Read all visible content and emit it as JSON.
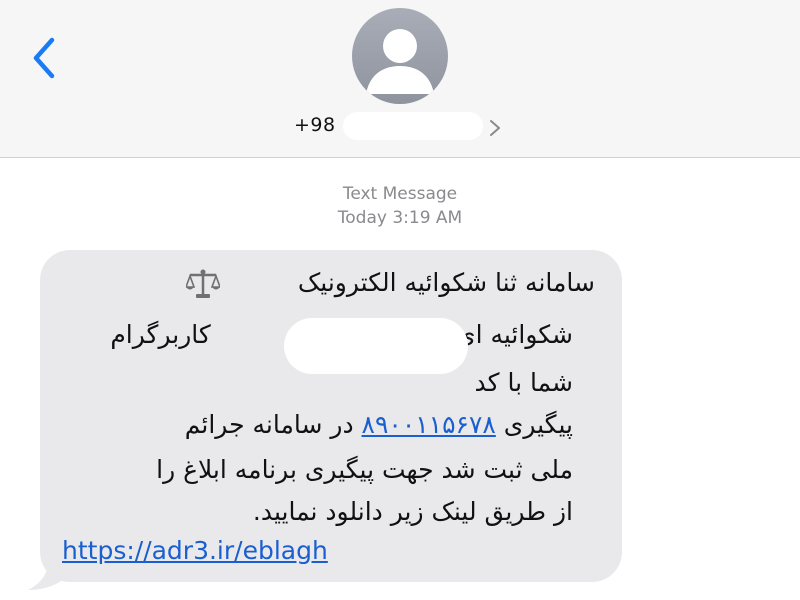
{
  "header": {
    "back_icon": "chevron-left-icon",
    "avatar_icon": "person-icon",
    "contact_number": "+98",
    "contact_chevron_icon": "chevron-right-icon",
    "accent_color": "#1a7cf5"
  },
  "conversation": {
    "service_label": "Text Message",
    "timestamp": "Today 3:19 AM"
  },
  "message": {
    "bubble_color": "#e9e9eb",
    "line1": "سامانه ثنا شکوائیه الکترونیک",
    "line2_right": "کاربرگرام",
    "line2_left": "شکوائیه ای برای",
    "line3": "شما با کد",
    "line4_start": "پیگیری",
    "tracking_code": "۸۹۰۰۱۱۵۶۷۸",
    "line4_end": "در سامانه جرائم",
    "line5": "ملی ثبت شد جهت پیگیری برنامه ابلاغ را",
    "line6": "از طریق لینک زیر دانلود نمایید.",
    "link": "https://adr3.ir/eblagh",
    "link_color": "#1a5fd0",
    "emoji_icon": "balance-scale-icon"
  }
}
